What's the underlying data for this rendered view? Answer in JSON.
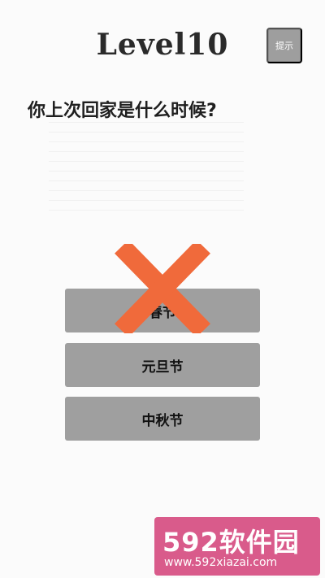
{
  "level": {
    "title": "Level10"
  },
  "hint": {
    "label": "提示"
  },
  "question": "你上次回家是什么时候?",
  "options": [
    {
      "label": "春节",
      "state": "wrong",
      "marker_color": "#f06a3b"
    },
    {
      "label": "元旦节"
    },
    {
      "label": "中秋节"
    }
  ],
  "watermark": {
    "top": "592软件园",
    "bottom": "www.592xiazai.com"
  },
  "colors": {
    "option_bg": "#9f9f9f",
    "hint_bg": "#9e9e9e",
    "wrong_mark": "#f06a3b",
    "watermark_bg": "#d95b8b"
  }
}
